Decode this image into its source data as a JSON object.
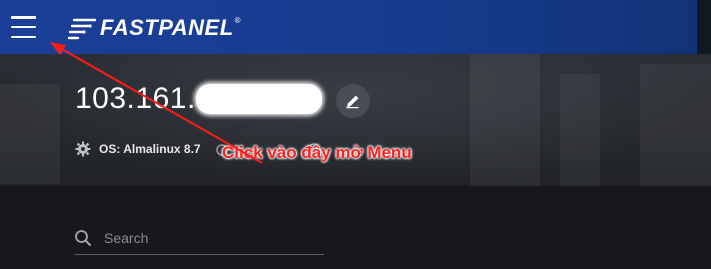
{
  "header": {
    "brand_name": "FASTPANEL",
    "brand_mark": "®",
    "menu_icon": "hamburger-menu-icon",
    "logo_icon": "fastpanel-logo-icon",
    "background": "#1a3d93"
  },
  "server": {
    "ip_visible": "103.161.",
    "edit_icon": "pencil-icon",
    "os_icon": "gear-icon",
    "os_label": "OS: Almalinux 8.7"
  },
  "annotation": {
    "text": "Click vào đây mở Menu",
    "color": "#ff2020"
  },
  "search": {
    "placeholder": "Search",
    "icon": "search-icon"
  }
}
